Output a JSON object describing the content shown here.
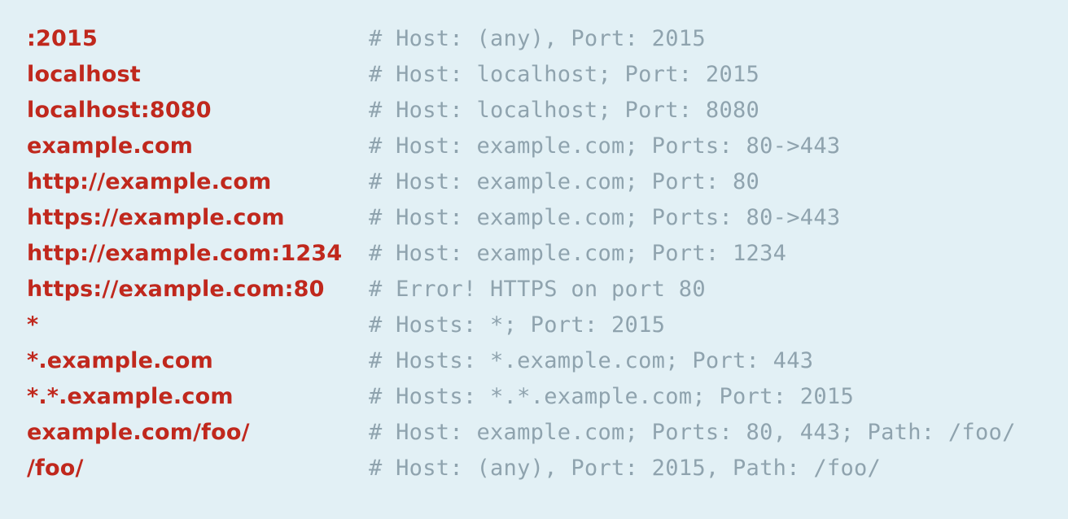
{
  "colors": {
    "background": "#e2f0f5",
    "address": "#c0281d",
    "comment": "#8fa3ae"
  },
  "lines": [
    {
      "address": ":2015",
      "comment": "# Host: (any), Port: 2015"
    },
    {
      "address": "localhost",
      "comment": "# Host: localhost; Port: 2015"
    },
    {
      "address": "localhost:8080",
      "comment": "# Host: localhost; Port: 8080"
    },
    {
      "address": "example.com",
      "comment": "# Host: example.com; Ports: 80->443"
    },
    {
      "address": "http://example.com",
      "comment": "# Host: example.com; Port: 80"
    },
    {
      "address": "https://example.com",
      "comment": "# Host: example.com; Ports: 80->443"
    },
    {
      "address": "http://example.com:1234",
      "comment": "# Host: example.com; Port: 1234"
    },
    {
      "address": "https://example.com:80",
      "comment": "# Error! HTTPS on port 80"
    },
    {
      "address": "*",
      "comment": "# Hosts: *; Port: 2015"
    },
    {
      "address": "*.example.com",
      "comment": "# Hosts: *.example.com; Port: 443"
    },
    {
      "address": "*.*.example.com",
      "comment": "# Hosts: *.*.example.com; Port: 2015"
    },
    {
      "address": "example.com/foo/",
      "comment": "# Host: example.com; Ports: 80, 443; Path: /foo/"
    },
    {
      "address": "/foo/",
      "comment": "# Host: (any), Port: 2015, Path: /foo/"
    }
  ]
}
